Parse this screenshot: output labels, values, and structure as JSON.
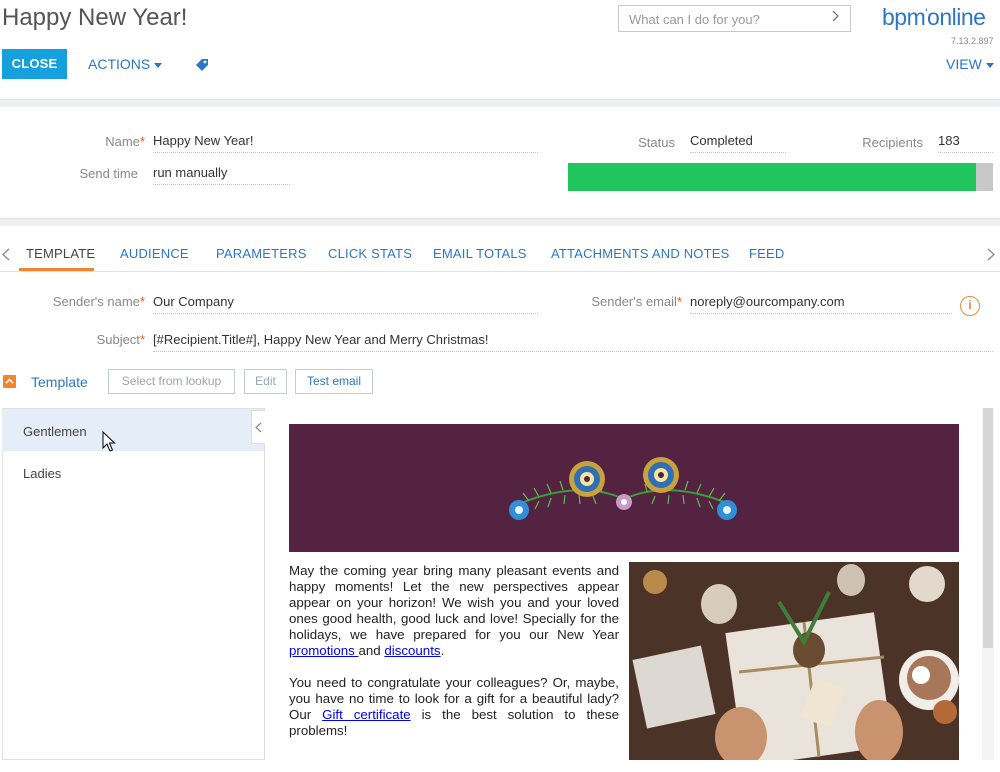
{
  "header": {
    "title": "Happy New Year!",
    "search_placeholder": "What can I do for you?",
    "logo_text": "bpm",
    "logo_tick": "'",
    "logo_text2": "online",
    "version": "7.13.2.897"
  },
  "toolbar": {
    "close_label": "CLOSE",
    "actions_label": "ACTIONS",
    "view_label": "VIEW"
  },
  "info": {
    "name_label": "Name",
    "name_value": "Happy New Year!",
    "send_time_label": "Send time",
    "send_time_value": "run manually",
    "status_label": "Status",
    "status_value": "Completed",
    "recipients_label": "Recipients",
    "recipients_value": "183",
    "progress_percent": 96
  },
  "tabs": [
    {
      "label": "TEMPLATE",
      "active": true
    },
    {
      "label": "AUDIENCE"
    },
    {
      "label": "PARAMETERS"
    },
    {
      "label": "CLICK STATS"
    },
    {
      "label": "EMAIL TOTALS"
    },
    {
      "label": "ATTACHMENTS AND NOTES"
    },
    {
      "label": "FEED"
    }
  ],
  "template_tab": {
    "sender_name_label": "Sender's name",
    "sender_name_value": "Our Company",
    "sender_email_label": "Sender's email",
    "sender_email_value": "noreply@ourcompany.com",
    "subject_label": "Subject",
    "subject_value": "[#Recipient.Title#], Happy New Year and Merry Christmas!",
    "section_label": "Template",
    "select_lookup_label": "Select from lookup",
    "edit_label": "Edit",
    "test_email_label": "Test email",
    "info_glyph": "i"
  },
  "template_list": [
    {
      "label": "Gentlemen",
      "selected": true
    },
    {
      "label": "Ladies",
      "selected": false
    }
  ],
  "email": {
    "p1_a": "May the coming year bring many pleasant events and happy moments! Let the new perspectives appear appear on your horizon! We wish you and your loved ones good health, good luck and love! Specially for the holidays, we have prepared for you our New Year ",
    "p1_link1": "promotions ",
    "p1_mid": "and ",
    "p1_link2": "discounts",
    "p1_end": ".",
    "p2_a": "You need to congratulate your colleagues? Or, maybe, you have no time to look for a gift for a beautiful lady? Our ",
    "p2_link": "Gift certificate",
    "p2_end": " is the best solution to these problems!"
  },
  "colors": {
    "accent": "#16a0de",
    "link": "#2b77c4",
    "progress": "#21c55d",
    "banner": "#542341",
    "tab_active": "#f0852d"
  }
}
